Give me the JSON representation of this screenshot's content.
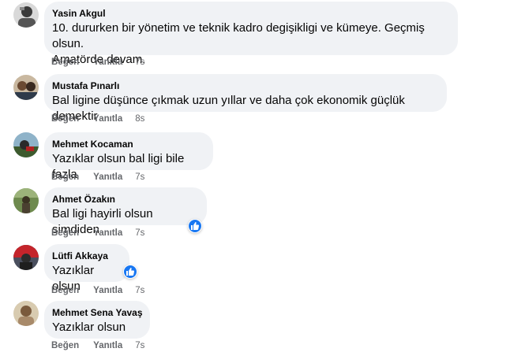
{
  "actions": {
    "like": "Beğen",
    "reply": "Yanıtla"
  },
  "comments": [
    {
      "author": "Yasin Akgul",
      "lines": [
        "10. dururken bir yönetim ve teknik kadro degişikligi ve kümeye. Geçmiş olsun.",
        "Amatörde devam."
      ],
      "time": "7s",
      "has_like": false
    },
    {
      "author": "Mustafa Pınarlı",
      "lines": [
        "Bal ligine düşünce çıkmak uzun yıllar ve daha çok ekonomik güçlük demektir"
      ],
      "time": "8s",
      "has_like": false
    },
    {
      "author": "Mehmet Kocaman",
      "lines": [
        "Yazıklar olsun bal ligi bile fazla"
      ],
      "time": "7s",
      "has_like": false
    },
    {
      "author": "Ahmet Özakın",
      "lines": [
        "Bal ligi hayirli olsun simdiden"
      ],
      "time": "7s",
      "has_like": true
    },
    {
      "author": "Lütfi Akkaya",
      "lines": [
        "Yazıklar olsun"
      ],
      "time": "7s",
      "has_like": true
    },
    {
      "author": "Mehmet Sena Yavaş",
      "lines": [
        "Yazıklar olsun"
      ],
      "time": "7s",
      "has_like": false
    }
  ],
  "colors": {
    "bubble": "#f0f2f5",
    "like_blue": "#1877f2",
    "meta_gray": "#65676b"
  }
}
